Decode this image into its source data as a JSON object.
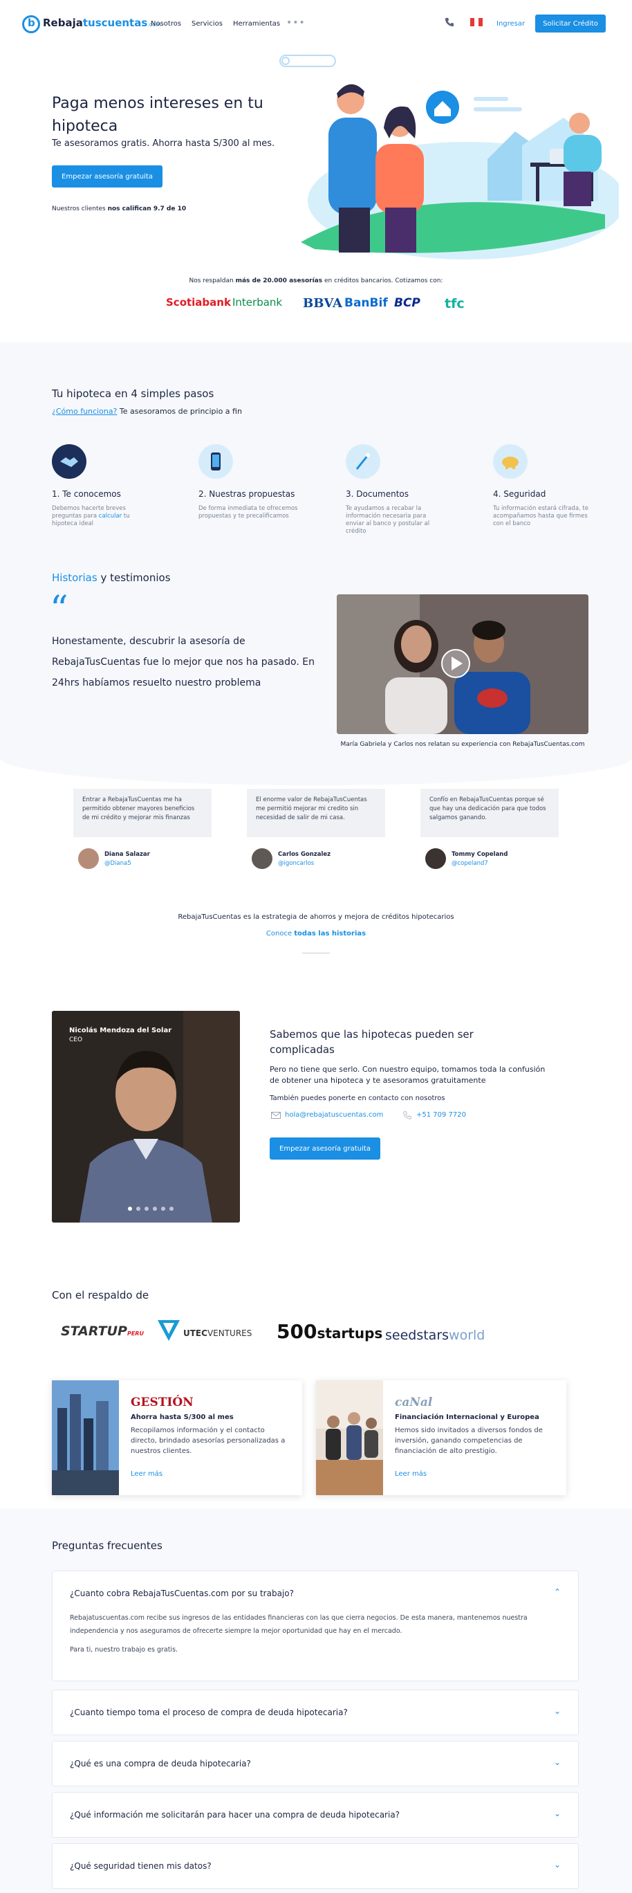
{
  "header": {
    "logo_primary": "Rebaja",
    "logo_secondary": "tuscuentas",
    "logo_suffix": ".com",
    "nav": [
      "Nosotros",
      "Servicios",
      "Herramientas"
    ],
    "more": "•••",
    "ingresar": "Ingresar",
    "solicitar": "Solicitar Crédito"
  },
  "hero": {
    "title": "Paga menos intereses en tu hipoteca",
    "subtitle": "Te asesoramos gratis. Ahorra hasta S/300 al mes.",
    "button": "Empezar asesoría gratuita",
    "note_prefix": "Nuestros clientes ",
    "note_bold": "nos califican 9.7 de 10"
  },
  "support": {
    "prefix": "Nos respaldan ",
    "bold": "más de 20.000 asesorías",
    "suffix": " en créditos bancarios. Cotizamos con:",
    "banks": [
      "Scotiabank",
      "Interbank",
      "BBVA",
      "BanBif",
      "BCP",
      "tfc"
    ]
  },
  "steps": {
    "title": "Tu hipoteca en 4 simples pasos",
    "link": "¿Cómo funciona?",
    "subtitle": "Te asesoramos de principio a fin",
    "items": [
      {
        "title": "1. Te conocemos",
        "desc_a": "Debemos hacerte breves preguntas para ",
        "desc_link": "calcular",
        "desc_b": " tu hipoteca ideal"
      },
      {
        "title": "2. Nuestras propuestas",
        "desc_a": "De forma inmediata te ofrecemos propuestas y te precalificamos",
        "desc_link": "",
        "desc_b": ""
      },
      {
        "title": "3. Documentos",
        "desc_a": "Te ayudamos a recabar la información necesaria para enviar al banco y postular al crédito",
        "desc_link": "",
        "desc_b": ""
      },
      {
        "title": "4. Seguridad",
        "desc_a": "Tu información estará cifrada, te acompañamos hasta que firmes con el banco",
        "desc_link": "",
        "desc_b": ""
      }
    ]
  },
  "history": {
    "title_blue": "Historias",
    "title_rest": " y testimonios",
    "quote_mark": "“",
    "quote": "Honestamente, descubrir la asesoría de RebajaTusCuentas fue lo mejor que nos ha pasado. En 24hrs habíamos resuelto nuestro problema",
    "video_caption": "María Gabriela y Carlos nos relatan su experiencia con RebajaTusCuentas.com"
  },
  "testimonials": [
    {
      "text": "Entrar a RebajaTusCuentas me ha permitido obtener mayores beneficios de mi crédito y mejorar mis finanzas",
      "name": "Diana Salazar",
      "handle": "@Diana5"
    },
    {
      "text": "El enorme valor de RebajaTusCuentas me permitió mejorar mi credito sin necesidad de salir de mi casa.",
      "name": "Carlos Gonzalez",
      "handle": "@igoncarlos"
    },
    {
      "text": "Confío en RebajaTusCuentas porque sé que hay una dedicación para que todos salgamos ganando.",
      "name": "Tommy Copeland",
      "handle": "@copeland7"
    }
  ],
  "strategy": {
    "text": "RebajaTusCuentas es la estrategia de ahorros y mejora de créditos hipotecarios",
    "link_prefix": "Conoce ",
    "link": "todas las historias"
  },
  "ceo": {
    "name": "Nicolás Mendoza del Solar",
    "role": "CEO",
    "title": "Sabemos que las hipotecas pueden ser complicadas",
    "text": "Pero no tiene que serlo. Con nuestro equipo, tomamos toda la confusión de obtener una hipoteca y te asesoramos gratuitamente",
    "contact": "También puedes ponerte en contacto con nosotros",
    "email": "hola@rebajatuscuentas.com",
    "phone": "+51 709 7720",
    "button": "Empezar asesoría gratuita"
  },
  "backing": {
    "title": "Con el respaldo de",
    "partners": [
      "STARTUP",
      "PERU",
      "UTEC",
      "VENTURES",
      "500",
      "startups",
      "seedstars",
      "world"
    ],
    "press": [
      {
        "logo": "GESTIÓN",
        "head": "Ahorra hasta S/300 al mes",
        "body": "Recopilamos información y el contacto directo, brindado asesorías personalizadas a nuestros clientes.",
        "more": "Leer más"
      },
      {
        "logo": "caNal",
        "head": "Financiación Internacional y Europea",
        "body": "Hemos sido invitados a diversos fondos de inversión, ganando competencias de financiación de alto prestigio.",
        "more": "Leer más"
      }
    ]
  },
  "faq": {
    "title": "Preguntas frecuentes",
    "open": {
      "q": "¿Cuanto cobra RebajaTusCuentas.com por su trabajo?",
      "a1": "Rebajatuscuentas.com recibe sus ingresos de las entidades financieras con las que cierra negocios. De esta manera, mantenemos nuestra independencia y nos aseguramos de ofrecerte siempre la mejor oportunidad que hay en el mercado.",
      "a2": "Para ti, nuestro trabajo es gratis."
    },
    "items": [
      "¿Cuanto tiempo toma el proceso de compra de deuda hipotecaria?",
      "¿Qué es una compra de deuda hipotecaria?",
      "¿Qué información me solicitarán para hacer una compra de deuda hipotecaria?",
      "¿Qué seguridad tienen mis datos?"
    ]
  },
  "colors": {
    "accent": "#1a8fe3",
    "text": "#1c2541",
    "muted": "#7b8494"
  }
}
